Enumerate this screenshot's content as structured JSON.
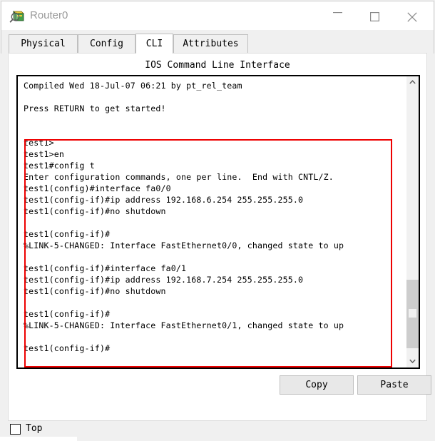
{
  "window": {
    "title": "Router0",
    "icon": "router-device-icon",
    "controls": {
      "minimize": "minimize-icon",
      "maximize": "maximize-icon",
      "close": "close-icon"
    }
  },
  "tabs": [
    {
      "label": "Physical",
      "active": false
    },
    {
      "label": "Config",
      "active": false
    },
    {
      "label": "CLI",
      "active": true
    },
    {
      "label": "Attributes",
      "active": false
    }
  ],
  "panel": {
    "title": "IOS Command Line Interface"
  },
  "terminal": {
    "lines": [
      "Compiled Wed 18-Jul-07 06:21 by pt_rel_team",
      "",
      "Press RETURN to get started!",
      "",
      "",
      "test1>",
      "test1>en",
      "test1#config t",
      "Enter configuration commands, one per line.  End with CNTL/Z.",
      "test1(config)#interface fa0/0",
      "test1(config-if)#ip address 192.168.6.254 255.255.255.0",
      "test1(config-if)#no shutdown",
      "",
      "test1(config-if)#",
      "%LINK-5-CHANGED: Interface FastEthernet0/0, changed state to up",
      "",
      "test1(config-if)#interface fa0/1",
      "test1(config-if)#ip address 192.168.7.254 255.255.255.0",
      "test1(config-if)#no shutdown",
      "",
      "test1(config-if)#",
      "%LINK-5-CHANGED: Interface FastEthernet0/1, changed state to up",
      "",
      "test1(config-if)#"
    ],
    "text": "Compiled Wed 18-Jul-07 06:21 by pt_rel_team\n\nPress RETURN to get started!\n\n\ntest1>\ntest1>en\ntest1#config t\nEnter configuration commands, one per line.  End with CNTL/Z.\ntest1(config)#interface fa0/0\ntest1(config-if)#ip address 192.168.6.254 255.255.255.0\ntest1(config-if)#no shutdown\n\ntest1(config-if)#\n%LINK-5-CHANGED: Interface FastEthernet0/0, changed state to up\n\ntest1(config-if)#interface fa0/1\ntest1(config-if)#ip address 192.168.7.254 255.255.255.0\ntest1(config-if)#no shutdown\n\ntest1(config-if)#\n%LINK-5-CHANGED: Interface FastEthernet0/1, changed state to up\n\ntest1(config-if)#",
    "highlight_color": "#ee0000",
    "scrollbar": {
      "up_icon": "chevron-up-icon",
      "down_icon": "chevron-down-icon"
    }
  },
  "buttons": {
    "copy": "Copy",
    "paste": "Paste"
  },
  "footer": {
    "top_label": "Top",
    "top_checked": false
  }
}
